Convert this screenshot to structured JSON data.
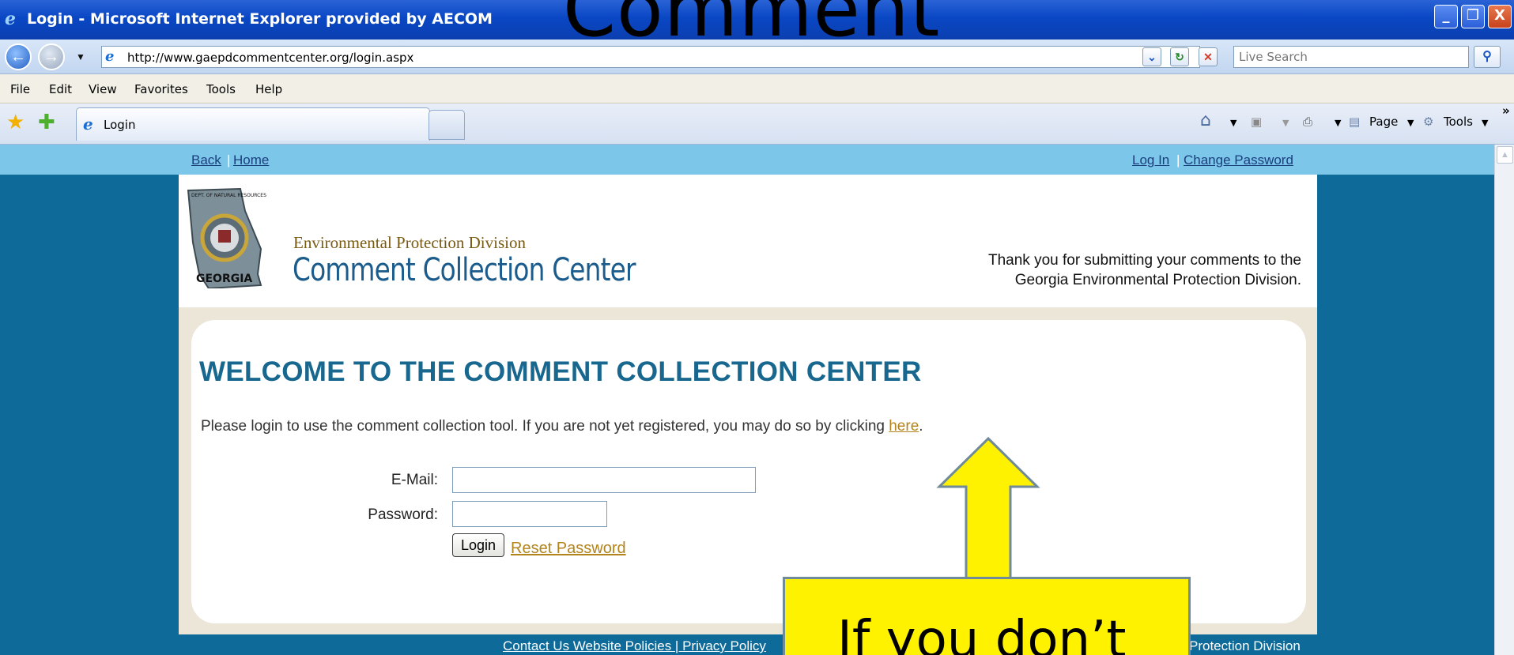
{
  "window": {
    "title": "Login - Microsoft Internet Explorer provided by AECOM",
    "minimize": "_",
    "restore": "❐",
    "close": "X"
  },
  "overlay": {
    "heading": "Comment",
    "callout": "If you don’t"
  },
  "address_bar": {
    "url": "http://www.gaepdcommentcenter.org/login.aspx",
    "search_placeholder": "Live Search"
  },
  "menu": [
    "File",
    "Edit",
    "View",
    "Favorites",
    "Tools",
    "Help"
  ],
  "tab": {
    "label": "Login"
  },
  "command_bar": {
    "page": "Page",
    "tools": "Tools"
  },
  "site_nav": {
    "back": "Back",
    "home": "Home",
    "login": "Log In",
    "change_password": "Change Password"
  },
  "header": {
    "seal_top": "DEPT. OF NATURAL RESOURCES",
    "seal_bottom": "GEORGIA",
    "division": "Environmental Protection Division",
    "center": "Comment Collection Center",
    "thanks_line1": "Thank you for submitting your comments to the",
    "thanks_line2": "Georgia Environmental Protection Division."
  },
  "login": {
    "welcome": "WELCOME TO THE COMMENT COLLECTION CENTER",
    "intro": "Please login to use the comment collection tool. If you are not yet registered, you may do so by clicking ",
    "here": "here",
    "period": ".",
    "email_label": "E-Mail:",
    "password_label": "Password:",
    "email_value": "",
    "password_value": "",
    "login_button": "Login",
    "reset_link": "Reset Password"
  },
  "footer": {
    "links": "Contact Us Website Policies | Privacy Policy",
    "right": "Protection Division"
  },
  "colors": {
    "page_bg": "#0e6a98",
    "nav_bg": "#7cc6ea",
    "heading": "#17678f",
    "link_gold": "#b3841b",
    "callout": "#fff200"
  }
}
